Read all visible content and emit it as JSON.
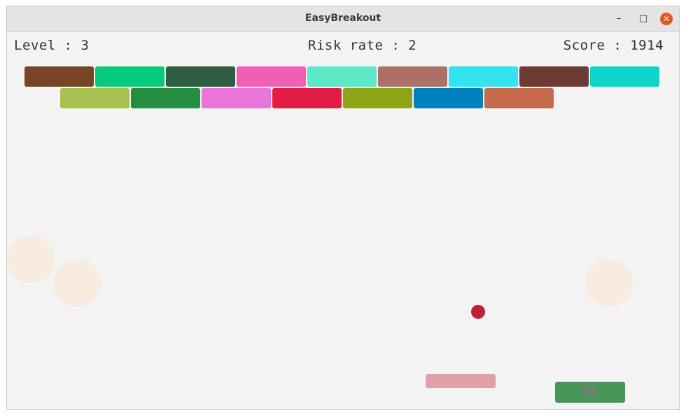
{
  "window": {
    "title": "EasyBreakout",
    "controls": {
      "minimize": "–",
      "maximize": "□",
      "close": "✕"
    }
  },
  "hud": {
    "level": "Level : 3",
    "risk": "Risk rate : 2",
    "score": "Score : 1914"
  },
  "timer": "93",
  "bricks": {
    "row1": [
      "#774526",
      "#06c97a",
      "#2f5e40",
      "#ef5fb2",
      "#5ceac6",
      "#ac7066",
      "#33e3ef",
      "#6d3b34",
      "#0cd6c9"
    ],
    "row2": [
      "#a7c250",
      "#238d40",
      "#ea75d8",
      "#e21d43",
      "#8da417",
      "#0080bd",
      "#c56c4e"
    ]
  },
  "colors": {
    "ball": "#c41e36",
    "paddle": "#e0a0a8",
    "timer_bg": "#479658",
    "bubble": "#f7ecdd"
  }
}
